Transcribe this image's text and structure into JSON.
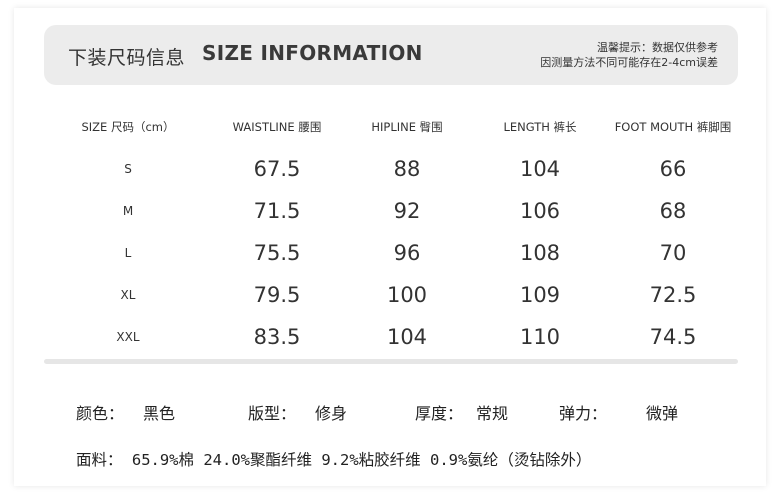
{
  "header": {
    "title_cn": "下装尺码信息",
    "title_en": "SIZE INFORMATION",
    "tip_line1": "温馨提示：数据仅供参考",
    "tip_line2": "因测量方法不同可能存在2-4cm误差"
  },
  "table": {
    "columns": [
      "SIZE 尺码（cm）",
      "WAISTLINE 腰围",
      "HIPLINE 臀围",
      "LENGTH 裤长",
      "FOOT MOUTH 裤脚围"
    ],
    "rows": [
      [
        "S",
        "67.5",
        "88",
        "104",
        "66"
      ],
      [
        "M",
        "71.5",
        "92",
        "106",
        "68"
      ],
      [
        "L",
        "75.5",
        "96",
        "108",
        "70"
      ],
      [
        "XL",
        "79.5",
        "100",
        "109",
        "72.5"
      ],
      [
        "XXL",
        "83.5",
        "104",
        "110",
        "74.5"
      ]
    ]
  },
  "specs": {
    "color_label": "颜色：",
    "color_value": "黑色",
    "fit_label": "版型：",
    "fit_value": "修身",
    "thickness_label": "厚度：",
    "thickness_value": "常规",
    "elasticity_label": "弹力：",
    "elasticity_value": "微弹"
  },
  "fabric": {
    "label": "面料：",
    "value": "65.9%棉 24.0%聚酯纤维 9.2%粘胶纤维 0.9%氨纶（烫钻除外）"
  }
}
